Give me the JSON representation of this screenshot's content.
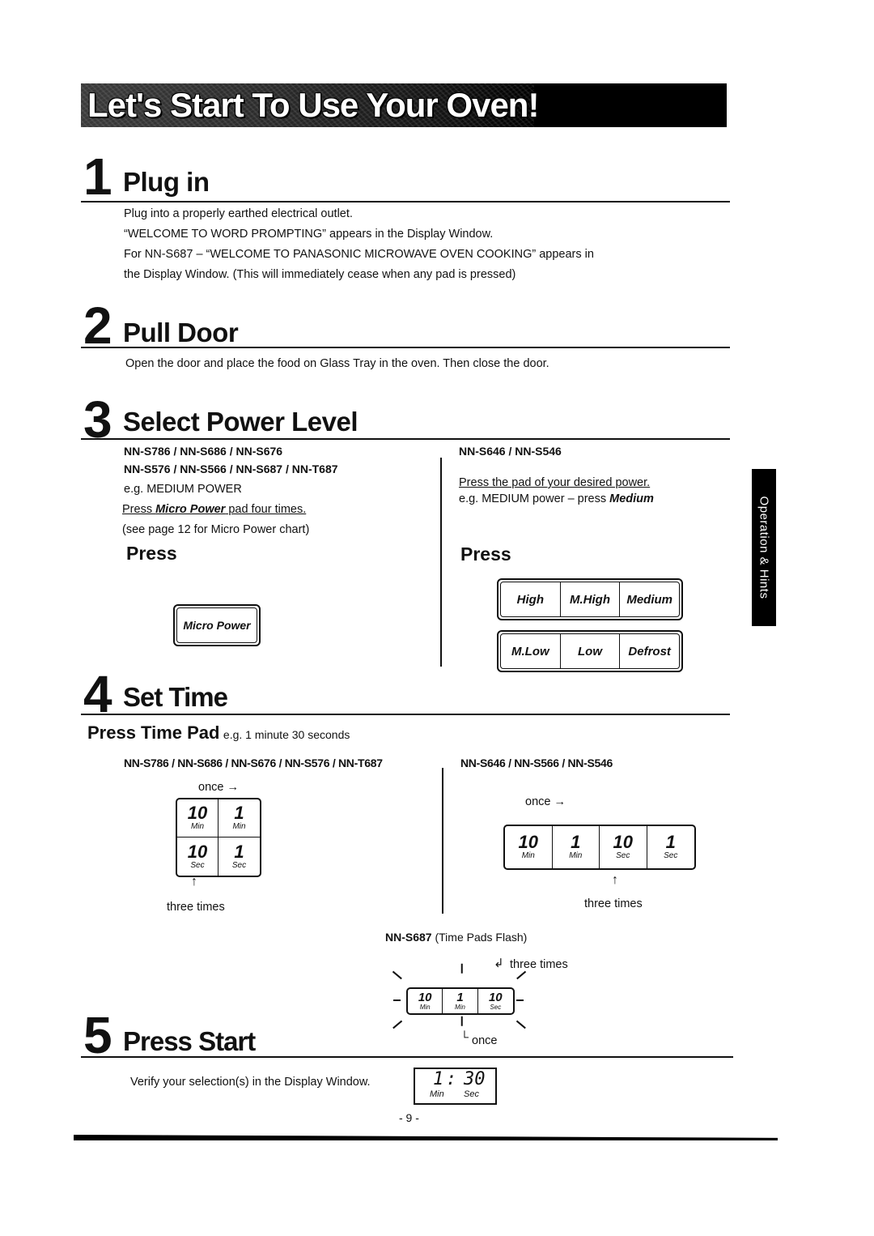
{
  "banner": {
    "title": "Let's Start To Use Your Oven!"
  },
  "side_tab": {
    "label": "Operation & Hints"
  },
  "steps": {
    "step1": {
      "number": "1",
      "title": "Plug in",
      "lines": [
        "Plug into a properly earthed electrical outlet.",
        "“WELCOME TO WORD PROMPTING” appears in the Display Window.",
        "For NN-S687 – “WELCOME TO PANASONIC MICROWAVE OVEN COOKING” appears in",
        "the Display Window. (This will immediately cease when any pad is pressed)"
      ]
    },
    "step2": {
      "number": "2",
      "title": "Pull Door",
      "text": "Open the door and place the food on Glass Tray in the oven. Then close the door."
    },
    "step3": {
      "number": "3",
      "title": "Select Power Level",
      "left": {
        "models_line1": "NN-S786 / NN-S686 / NN-S676",
        "models_line2": "NN-S576 / NN-S566 / NN-S687 / NN-T687",
        "example": "e.g. MEDIUM POWER",
        "instr_pre": "Press ",
        "instr_pad": "Micro Power",
        "instr_post": " pad four times.",
        "note": "(see page 12 for Micro Power chart)",
        "press_label": "Press",
        "pad_label": "Micro Power"
      },
      "right": {
        "models": "NN-S646 / NN-S546",
        "instr": "Press the pad of your desired power.",
        "example_pre": "e.g. MEDIUM power – press ",
        "example_pad": "Medium",
        "press_label": "Press",
        "pads_row1": [
          "High",
          "M.High",
          "Medium"
        ],
        "pads_row2": [
          "M.Low",
          "Low",
          "Defrost"
        ]
      }
    },
    "step4": {
      "number": "4",
      "title": "Set Time",
      "press_time_pad": "Press Time Pad",
      "example": "e.g. 1 minute 30 seconds",
      "left": {
        "models": "NN-S786 / NN-S686 / NN-S676 / NN-S576 / NN-T687",
        "once_label": "once →",
        "pads": [
          {
            "num": "10",
            "unit": "Min"
          },
          {
            "num": "1",
            "unit": "Min"
          },
          {
            "num": "10",
            "unit": "Sec"
          },
          {
            "num": "1",
            "unit": "Sec"
          }
        ],
        "arrow": "↑",
        "three_times": "three times"
      },
      "right": {
        "models": "NN-S646 / NN-S566 / NN-S546",
        "once_label": "once →",
        "pads": [
          {
            "num": "10",
            "unit": "Min"
          },
          {
            "num": "1",
            "unit": "Min"
          },
          {
            "num": "10",
            "unit": "Sec"
          },
          {
            "num": "1",
            "unit": "Sec"
          }
        ],
        "arrow": "↑",
        "three_times": "three times"
      },
      "s687": {
        "model": "NN-S687",
        "note": "(Time Pads Flash)",
        "three_times": "three times",
        "once": "once",
        "pads": [
          {
            "num": "10",
            "unit": "Min"
          },
          {
            "num": "1",
            "unit": "Min"
          },
          {
            "num": "10",
            "unit": "Sec"
          }
        ]
      }
    },
    "step5": {
      "number": "5",
      "title": "Press Start",
      "text": "Verify your selection(s) in the Display Window.",
      "display": {
        "minutes": "1",
        "colon": ":",
        "seconds": "30",
        "min_label": "Min",
        "sec_label": "Sec"
      }
    }
  },
  "page_number": "- 9 -"
}
